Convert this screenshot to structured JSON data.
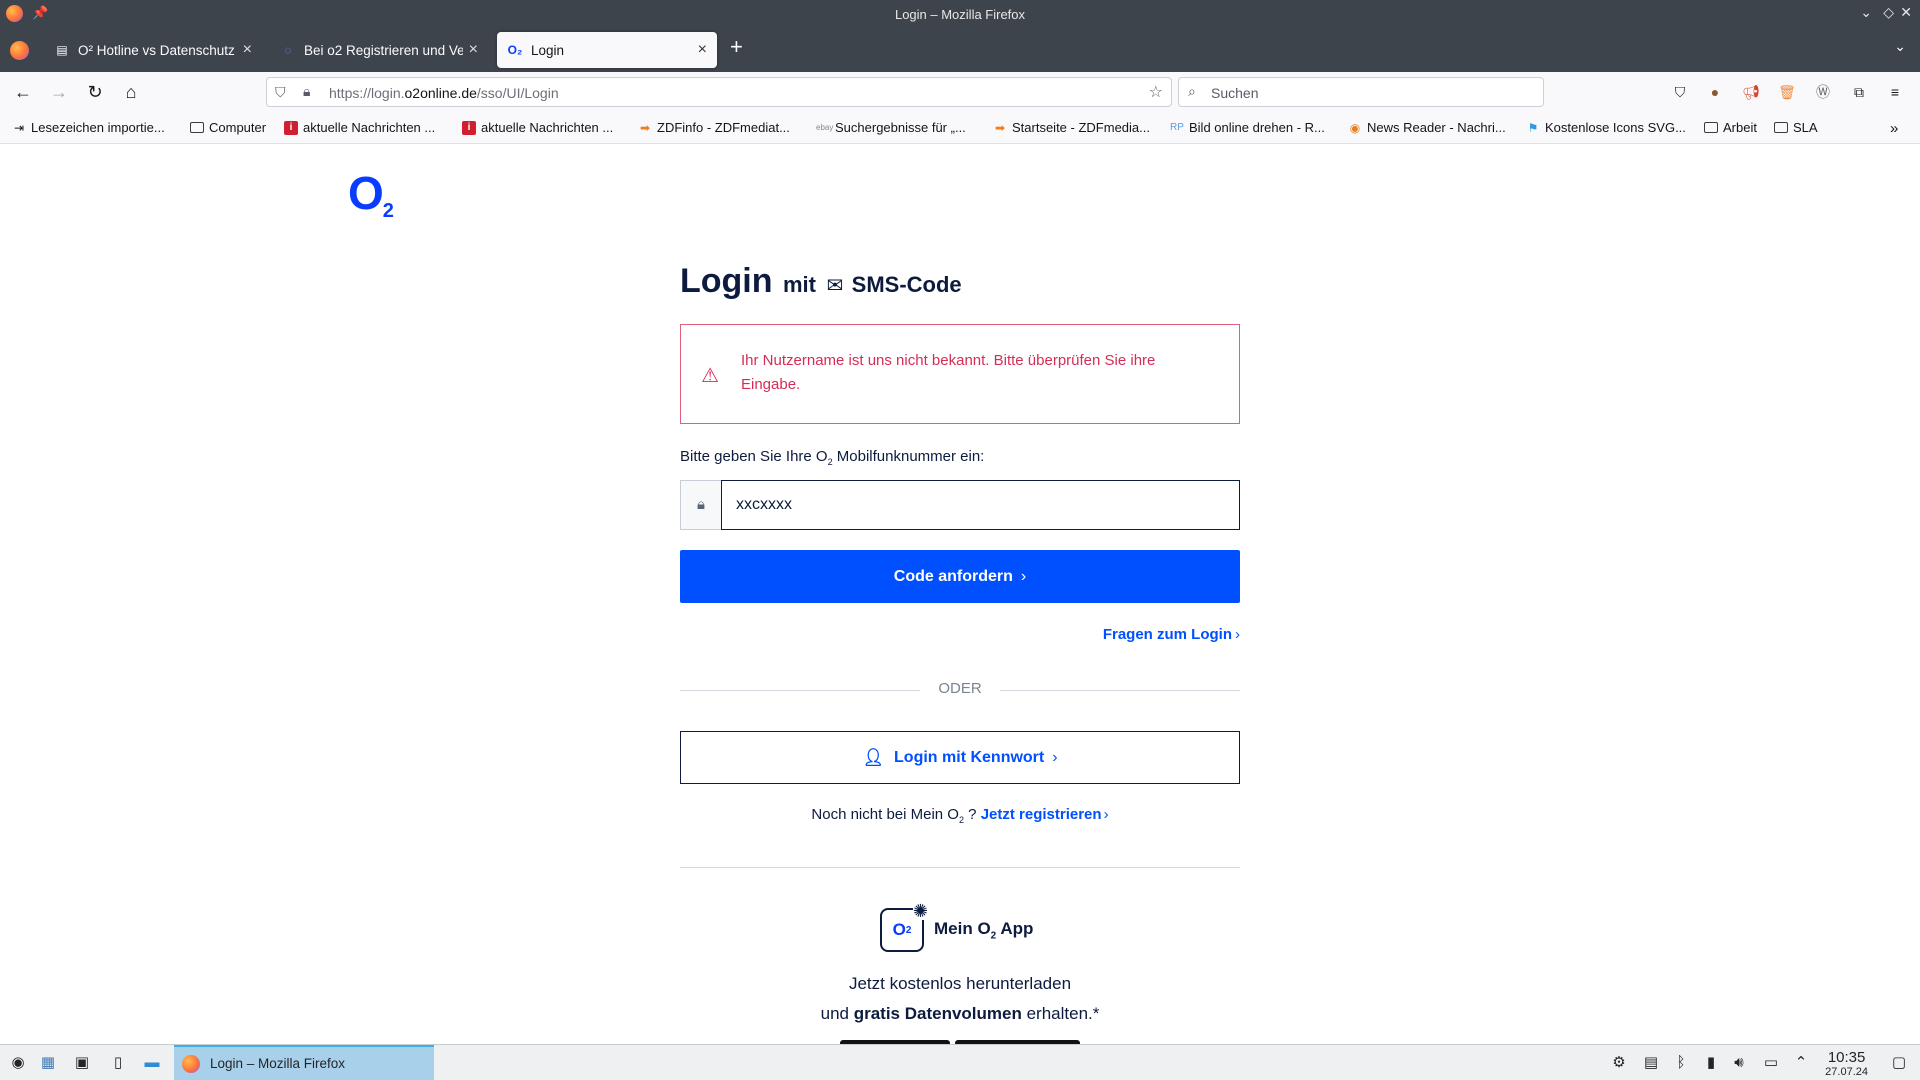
{
  "window": {
    "title": "Login – Mozilla Firefox"
  },
  "tabs": [
    {
      "label": "O² Hotline vs Datenschutz"
    },
    {
      "label": "Bei o2 Registrieren und Ve"
    },
    {
      "label": "Login"
    }
  ],
  "navbar": {
    "url_prefix": "https://login.",
    "url_domain": "o2online.de",
    "url_path": "/sso/UI/Login",
    "search_placeholder": "Suchen"
  },
  "bookmarks": [
    "Lesezeichen importie...",
    "Computer",
    "aktuelle Nachrichten ...",
    "aktuelle Nachrichten ...",
    "ZDFinfo - ZDFmediat...",
    "Suchergebnisse für „...",
    "Startseite - ZDFmedia...",
    "Bild online drehen - R...",
    "News Reader - Nachri...",
    "Kostenlose Icons SVG...",
    "Arbeit",
    "SLA"
  ],
  "page": {
    "logo": "O",
    "logo_sub": "2",
    "heading_main": "Login",
    "heading_mit": "mit",
    "heading_method": "SMS-Code",
    "error_message": "Ihr Nutzername ist uns nicht bekannt. Bitte überprüfen Sie ihre Eingabe.",
    "field_label_pre": "Bitte geben Sie Ihre O",
    "field_label_sub": "2",
    "field_label_post": " Mobilfunknummer ein:",
    "field_value": "xxcxxxx",
    "primary_button": "Code anfordern",
    "help_link": "Fragen zum Login",
    "separator": "ODER",
    "secondary_button": "Login mit Kennwort",
    "register_pre": "Noch nicht bei Mein O",
    "register_sub": "2",
    "register_q": " ? ",
    "register_link": "Jetzt registrieren",
    "app_icon_text": "O",
    "app_icon_sub": "2",
    "app_name_pre": "Mein O",
    "app_name_sub": "2",
    "app_name_post": " App",
    "app_line1": "Jetzt kostenlos herunterladen",
    "app_line2_pre": "und ",
    "app_line2_bold": "gratis Datenvolumen",
    "app_line2_post": " erhalten.*"
  },
  "taskbar": {
    "active_task": "Login – Mozilla Firefox",
    "time": "10:35",
    "date": "27.07.24"
  },
  "colors": {
    "o2_blue": "#0050ff",
    "navy": "#0d1b3e",
    "error": "#d62d55"
  }
}
